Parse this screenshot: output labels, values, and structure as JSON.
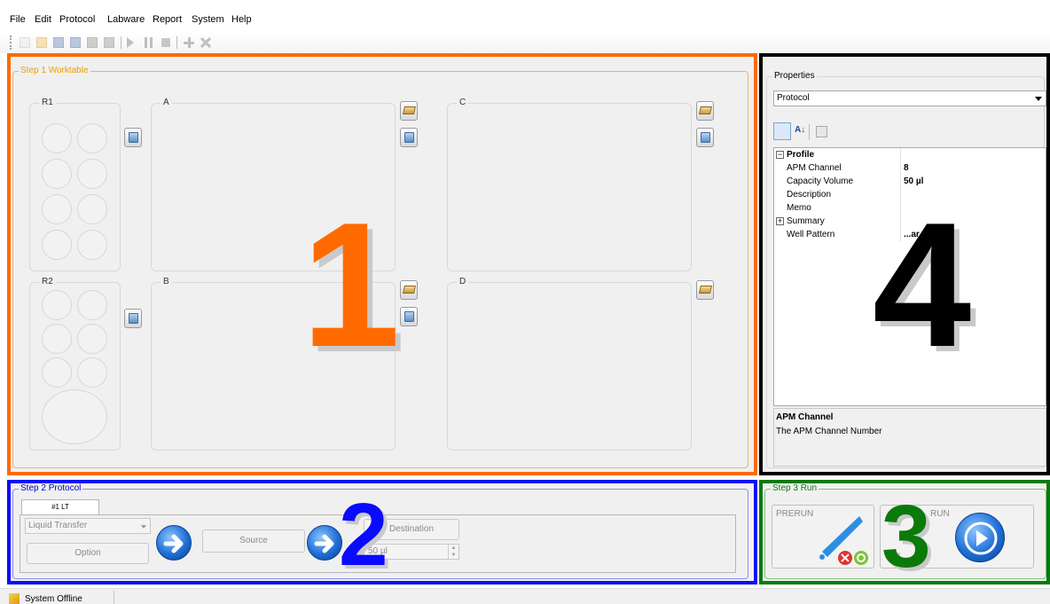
{
  "menu": [
    "File",
    "Edit",
    "Protocol",
    "Labware",
    "Report",
    "System",
    "Help"
  ],
  "worktable": {
    "title": "Step 1 Worktable",
    "zones": [
      "R1",
      "A",
      "C",
      "R2",
      "B",
      "D"
    ]
  },
  "protocol": {
    "title": "Step 2 Protocol",
    "tab": "#1 LT",
    "type_select": "Liquid Transfer",
    "option_button": "Option",
    "source_button": "Source",
    "destination_button": "Destination",
    "volume_value": "50 µl"
  },
  "run": {
    "title": "Step 3 Run",
    "prerun_label": "PRERUN",
    "run_label": "RUN"
  },
  "properties": {
    "title": "Properties",
    "object_select": "Protocol",
    "category": "Profile",
    "rows": [
      {
        "name": "APM Channel",
        "value": "8"
      },
      {
        "name": "Capacity Volume",
        "value": "50 µl"
      },
      {
        "name": "Description",
        "value": ""
      },
      {
        "name": "Memo",
        "value": ""
      },
      {
        "name": "Summary",
        "value": ""
      },
      {
        "name": "Well Pattern",
        "value": "...ar"
      }
    ],
    "help_title": "APM Channel",
    "help_text": "The APM Channel Number"
  },
  "status": {
    "text": "System Offline"
  },
  "annotations": {
    "n1": "1",
    "n2": "2",
    "n3": "3",
    "n4": "4"
  },
  "colors": {
    "worktable_highlight": "#ff6a00",
    "protocol_highlight": "#0a0aff",
    "run_highlight": "#0a7a0a",
    "properties_highlight": "#000000"
  }
}
